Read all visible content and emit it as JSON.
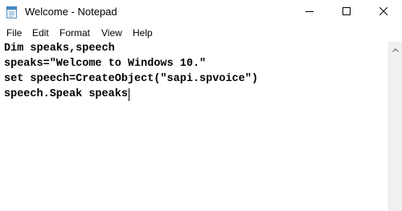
{
  "window": {
    "title": "Welcome - Notepad",
    "icon": "notepad-icon"
  },
  "controls": {
    "minimize_icon": "minimize-icon",
    "maximize_icon": "maximize-icon",
    "close_icon": "close-icon"
  },
  "menu": {
    "items": [
      {
        "label": "File"
      },
      {
        "label": "Edit"
      },
      {
        "label": "Format"
      },
      {
        "label": "View"
      },
      {
        "label": "Help"
      }
    ]
  },
  "editor": {
    "lines": [
      "Dim speaks,speech",
      "speaks=\"Welcome to Windows 10.\"",
      "set speech=CreateObject(\"sapi.spvoice\")",
      "speech.Speak speaks"
    ]
  },
  "scrollbar": {
    "up_icon": "scroll-up-arrow-icon"
  },
  "colors": {
    "background": "#ffffff",
    "text": "#000000",
    "scrollbar_track": "#f0f0f0"
  }
}
